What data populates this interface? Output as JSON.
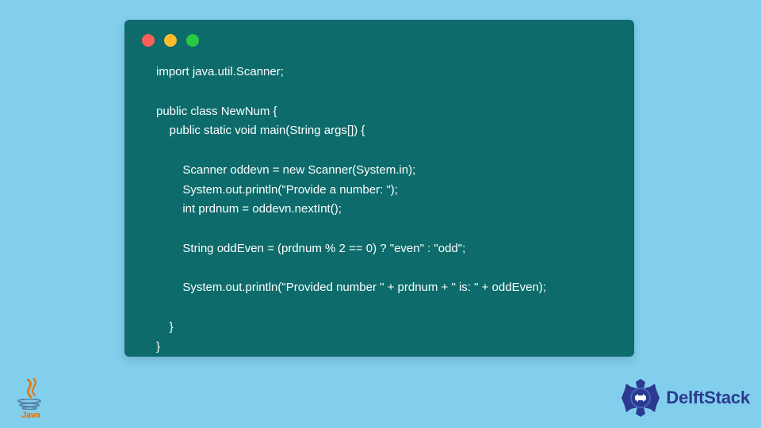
{
  "window": {
    "controls": [
      "red",
      "yellow",
      "green"
    ]
  },
  "code": {
    "lines": [
      "import java.util.Scanner;",
      "",
      "public class NewNum {",
      "    public static void main(String args[]) {",
      "",
      "        Scanner oddevn = new Scanner(System.in);",
      "        System.out.println(\"Provide a number: \");",
      "        int prdnum = oddevn.nextInt();",
      "",
      "        String oddEven = (prdnum % 2 == 0) ? \"even\" : \"odd\";",
      "",
      "        System.out.println(\"Provided number \" + prdnum + \" is: \" + oddEven);",
      "",
      "    }",
      "}"
    ]
  },
  "logos": {
    "java_label": "Java",
    "delftstack_label": "DelftStack"
  },
  "colors": {
    "background": "#82cfed",
    "code_bg": "#0d6b6b",
    "code_text": "#ffffff",
    "java_orange": "#e76f00",
    "java_blue": "#5382a1",
    "delft_blue": "#2b3a8f"
  }
}
